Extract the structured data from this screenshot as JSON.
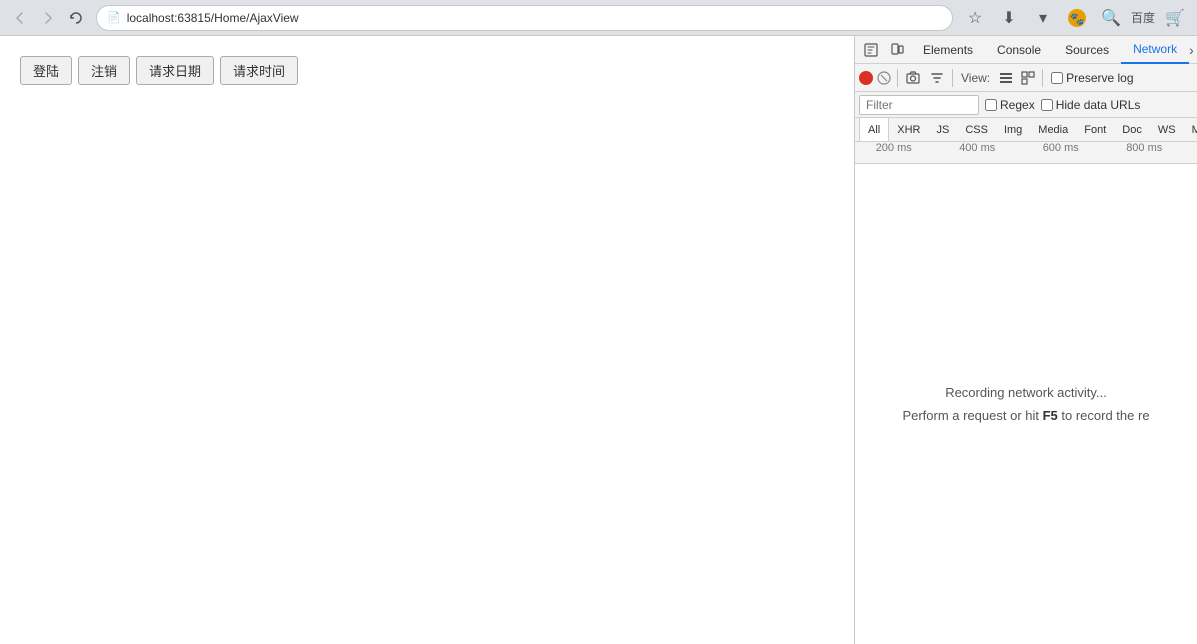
{
  "browser": {
    "back_disabled": true,
    "forward_disabled": true,
    "url": "localhost:63815/Home/AjaxView",
    "baidu_text": "百度",
    "nav_buttons": {
      "back": "←",
      "forward": "→",
      "bookmark": "☆",
      "history": "⊙"
    }
  },
  "page": {
    "buttons": [
      {
        "label": "登陆",
        "key": "login"
      },
      {
        "label": "注销",
        "key": "logout"
      },
      {
        "label": "请求日期",
        "key": "request-date"
      },
      {
        "label": "请求时间",
        "key": "request-time"
      }
    ]
  },
  "devtools": {
    "top_tabs": [
      {
        "label": "Elements",
        "key": "elements"
      },
      {
        "label": "Console",
        "key": "console"
      },
      {
        "label": "Sources",
        "key": "sources"
      },
      {
        "label": "Network",
        "key": "network",
        "active": true
      }
    ],
    "more_tabs": "»",
    "network": {
      "toolbar": {
        "view_label": "View:",
        "preserve_log_label": "Preserve log",
        "preserve_log_checked": false
      },
      "filter": {
        "placeholder": "Filter",
        "regex_label": "Regex",
        "regex_checked": false,
        "hide_data_urls_label": "Hide data URLs",
        "hide_data_urls_checked": false
      },
      "resource_tabs": [
        {
          "label": "All",
          "key": "all",
          "active": true
        },
        {
          "label": "XHR",
          "key": "xhr"
        },
        {
          "label": "JS",
          "key": "js"
        },
        {
          "label": "CSS",
          "key": "css"
        },
        {
          "label": "Img",
          "key": "img"
        },
        {
          "label": "Media",
          "key": "media"
        },
        {
          "label": "Font",
          "key": "font"
        },
        {
          "label": "Doc",
          "key": "doc"
        },
        {
          "label": "WS",
          "key": "ws"
        },
        {
          "label": "Manifest",
          "key": "manifest"
        }
      ],
      "timeline_labels": [
        {
          "text": "200 ms",
          "pos": 0
        },
        {
          "text": "400 ms",
          "pos": 1
        },
        {
          "text": "600 ms",
          "pos": 2
        },
        {
          "text": "800 ms",
          "pos": 3
        }
      ],
      "empty_message_line1": "Recording network activity...",
      "empty_message_line2": "Perform a request or hit ",
      "empty_message_key": "F5",
      "empty_message_line3": " to record the re"
    }
  }
}
